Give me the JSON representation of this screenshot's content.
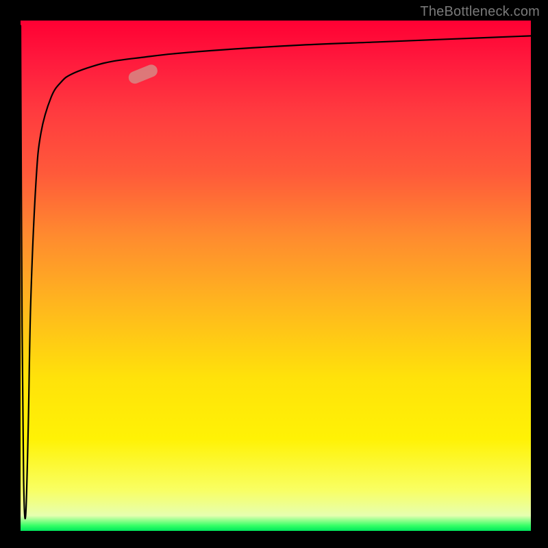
{
  "watermark": "TheBottleneck.com",
  "colors": {
    "bg": "#000000",
    "curve": "#000000",
    "marker": "#d68b86",
    "gradient_top": "#ff0033",
    "gradient_bottom": "#00e65c"
  },
  "chart_data": {
    "type": "line",
    "title": "",
    "xlabel": "",
    "ylabel": "",
    "xlim": [
      0,
      100
    ],
    "ylim": [
      0,
      100
    ],
    "grid": false,
    "legend": false,
    "series": [
      {
        "name": "curve",
        "x": [
          0,
          0.3,
          0.6,
          1,
          1.5,
          2,
          3,
          4,
          6,
          8,
          10,
          14,
          18,
          24,
          30,
          40,
          55,
          70,
          85,
          100
        ],
        "y": [
          99,
          40,
          10,
          3,
          20,
          45,
          68,
          78,
          85,
          88,
          89.5,
          91,
          92,
          92.8,
          93.5,
          94.3,
          95.2,
          95.8,
          96.4,
          97
        ]
      }
    ],
    "annotations": [
      {
        "type": "marker",
        "shape": "rounded-bar",
        "x": 24,
        "y": 89.5,
        "angle_deg": -22
      }
    ]
  }
}
